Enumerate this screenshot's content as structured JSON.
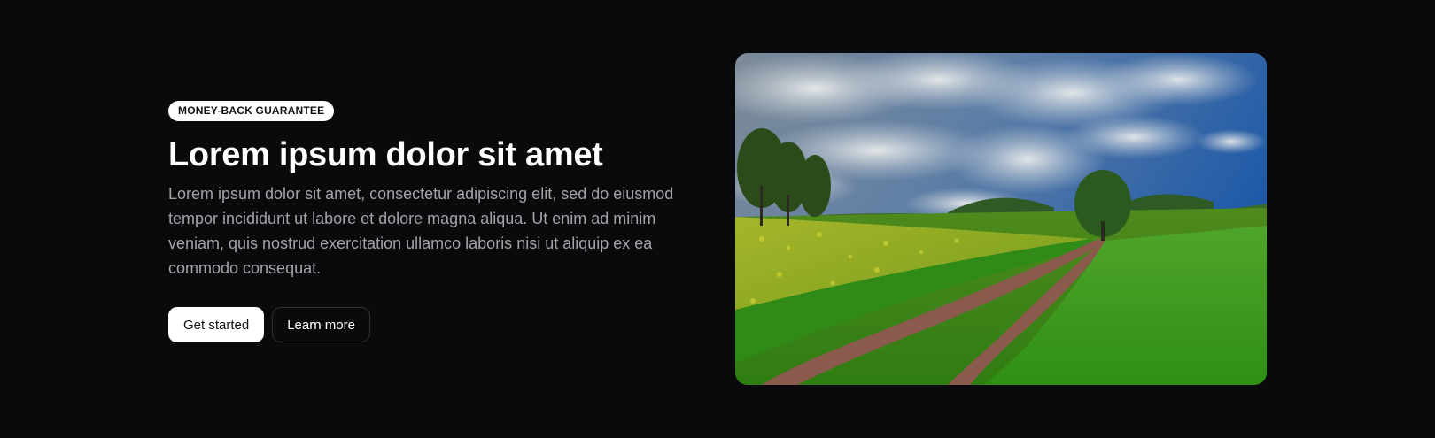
{
  "hero": {
    "badge": "MONEY-BACK GUARANTEE",
    "title": "Lorem ipsum dolor sit amet",
    "description": "Lorem ipsum dolor sit amet, consectetur adipiscing elit, sed do eiusmod tempor incididunt ut labore et dolore magna aliqua. Ut enim ad minim veniam, quis nostrud exercitation ullamco laboris nisi ut aliquip ex ea commodo consequat.",
    "primary_button": "Get started",
    "secondary_button": "Learn more"
  },
  "colors": {
    "background": "#0a0a0c",
    "text_primary": "#ffffff",
    "text_muted": "#a3a3a8",
    "button_border": "#2e2e33"
  }
}
